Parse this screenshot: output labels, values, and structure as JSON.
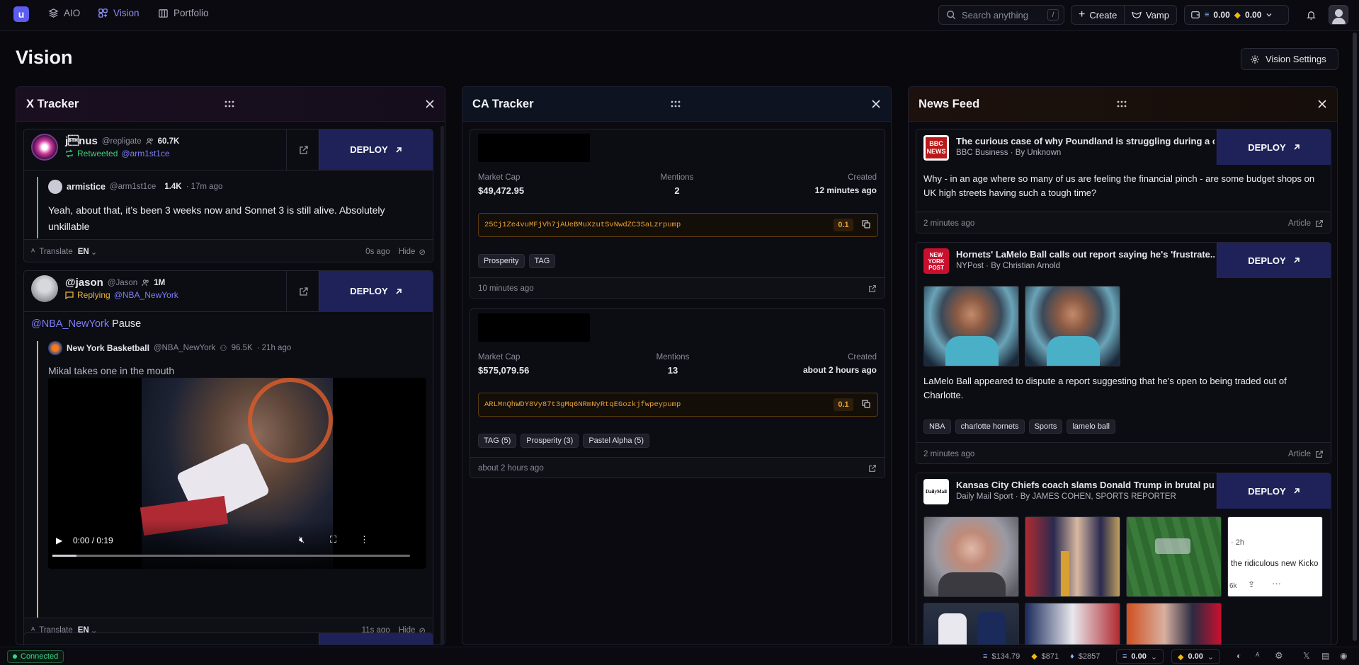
{
  "app": {
    "logo_letter": "u",
    "nav": [
      {
        "label": "AIO",
        "icon": "layers-icon"
      },
      {
        "label": "Vision",
        "icon": "grid-icon"
      },
      {
        "label": "Portfolio",
        "icon": "portfolio-icon"
      }
    ],
    "search_placeholder": "Search anything",
    "search_shortcut": "/",
    "create_label": "Create",
    "vamp_label": "Vamp",
    "wallet_sol": "0.00",
    "wallet_bnb": "0.00"
  },
  "page": {
    "title": "Vision",
    "settings_label": "Vision Settings"
  },
  "colors": {
    "accent": "#5c5cf0",
    "deploy_bg": "#1e2258",
    "retweet_green": "#3fd07a",
    "reply_yellow": "#e6b53a",
    "address_orange": "#e8a23a",
    "mention_link": "#7d7ff5"
  },
  "x_tracker": {
    "title": "X Tracker",
    "posts": [
      {
        "name": "j\u0002nus",
        "handle": "@repligate",
        "followers": "60.7K",
        "action": "Retweeted",
        "action_target": "@arm1st1ce",
        "deploy": "DEPLOY",
        "quoted": {
          "name": "armistice",
          "handle": "@arm1st1ce",
          "followers": "1.4K",
          "time": "· 17m ago",
          "text": "Yeah, about that, it’s been 3 weeks now and Sonnet 3 is still alive. Absolutely unkillable"
        },
        "translate": "Translate",
        "lang": "EN",
        "time": "0s ago",
        "hide": "Hide"
      },
      {
        "name": "@jason",
        "handle": "@Jason",
        "followers": "1M",
        "action": "Replying",
        "action_target": "@NBA_NewYork",
        "deploy": "DEPLOY",
        "text_mention": "@NBA_NewYork",
        "text": "Pause",
        "quoted": {
          "name": "New York Basketball",
          "handle": "@NBA_NewYork",
          "followers": "96.5K",
          "time": "· 21h ago",
          "text": "Mikal takes one in the mouth"
        },
        "video_time": "0:00 / 0:19",
        "translate": "Translate",
        "lang": "EN",
        "time": "11s ago",
        "hide": "Hide"
      }
    ]
  },
  "ca_tracker": {
    "title": "CA Tracker",
    "tokens": [
      {
        "market_cap_label": "Market Cap",
        "market_cap": "$49,472.95",
        "mentions_label": "Mentions",
        "mentions": "2",
        "created_label": "Created",
        "created": "12 minutes ago",
        "address": "25Cj1Ze4vuMFjVh7jAUeBMuXzutSvNwdZC3SaLzrpump",
        "amount": "0.1",
        "tags": [
          "Prosperity",
          "TAG"
        ],
        "footer_time": "10 minutes ago"
      },
      {
        "market_cap_label": "Market Cap",
        "market_cap": "$575,079.56",
        "mentions_label": "Mentions",
        "mentions": "13",
        "created_label": "Created",
        "created": "about 2 hours ago",
        "address": "ARLMnQhWDY8Vy87t3gMq6NRmNyRtqEGozkjfwpeypump",
        "amount": "0.1",
        "tags": [
          "TAG (5)",
          "Prosperity (3)",
          "Pastel Alpha (5)"
        ],
        "footer_time": "about 2 hours ago"
      }
    ]
  },
  "news_feed": {
    "title": "News Feed",
    "items": [
      {
        "headline": "The curious case of why Poundland is struggling during a c...",
        "source": "BBC Business · By Unknown",
        "body": "Why - in an age where so many of us are feeling the financial pinch - are some budget shops on UK high streets having such a tough time?",
        "time": "2 minutes ago",
        "link": "Article",
        "deploy": "DEPLOY",
        "logo": "BBC NEWS"
      },
      {
        "headline": "Hornets' LaMelo Ball calls out report saying he's 'frustrate...",
        "source": "NYPost · By Christian Arnold",
        "body": "LaMelo Ball appeared to dispute a report suggesting that he's open to being traded out of Charlotte.",
        "tags": [
          "NBA",
          "charlotte hornets",
          "Sports",
          "lamelo ball"
        ],
        "time": "2 minutes ago",
        "link": "Article",
        "deploy": "DEPLOY",
        "logo": "NEW YORK POST"
      },
      {
        "headline": "Kansas City Chiefs coach slams Donald Trump in brutal put...",
        "source": "Daily Mail Sport · By JAMES COHEN, SPORTS REPORTER",
        "deploy": "DEPLOY",
        "logo": "DailyMail",
        "embed_time": "· 2h",
        "embed_text": "the ridiculous new Kicko",
        "embed_count": "6k"
      }
    ]
  },
  "statusbar": {
    "connected": "Connected",
    "balance": "$134.79",
    "bnb_price": "$871",
    "eth_price": "$2857",
    "sol": "0.00",
    "bnb": "0.00"
  }
}
